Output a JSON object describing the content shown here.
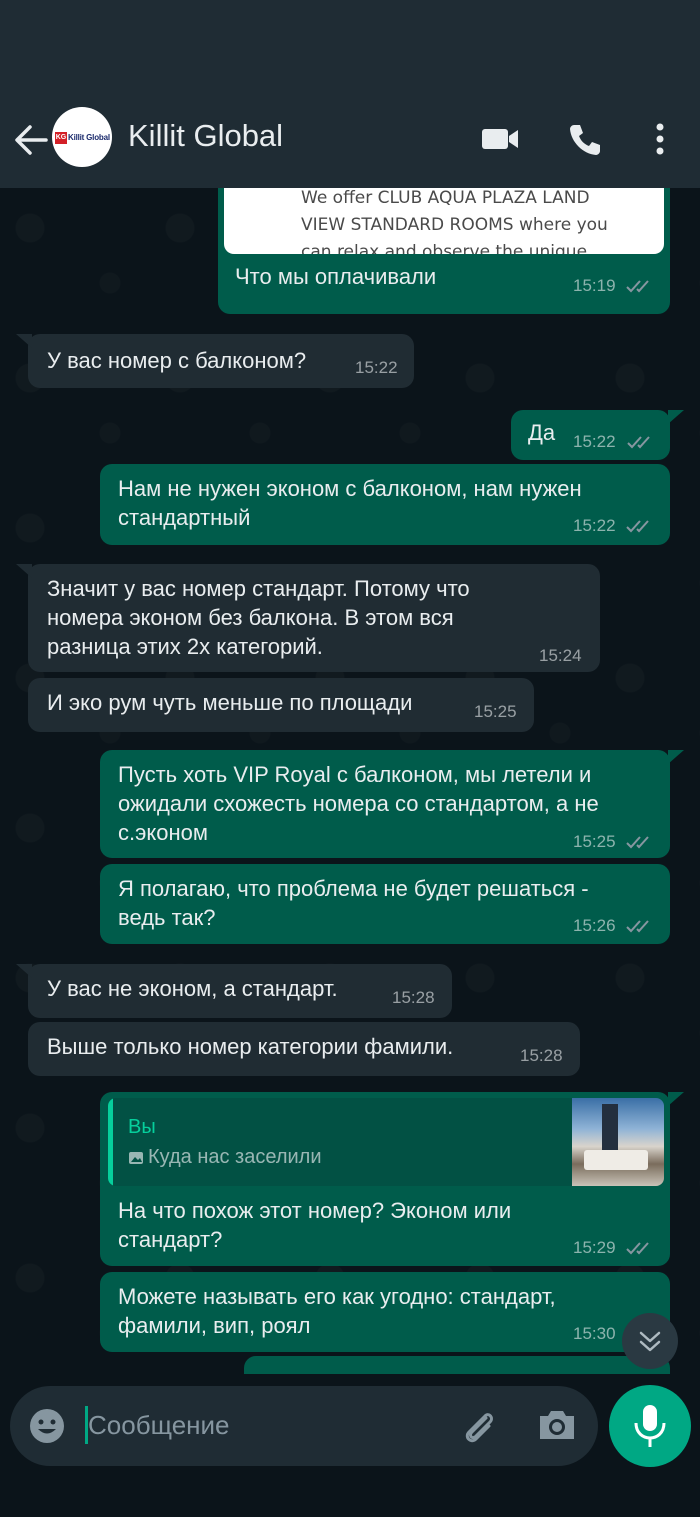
{
  "header": {
    "contact_name": "Killit Global",
    "avatar_logo_text": "Killit Global",
    "avatar_logo_mark": "KG"
  },
  "messages": [
    {
      "dir": "out",
      "preview_lines": [
        "We offer CLUB AQUA PLAZA LAND",
        "VIEW STANDARD ROOMS where you",
        "can relax and observe the unique"
      ],
      "text": "Что мы оплачивали",
      "time": "15:19"
    },
    {
      "dir": "in",
      "text": "У вас номер с балконом?",
      "time": "15:22"
    },
    {
      "dir": "out",
      "text": "Да",
      "time": "15:22"
    },
    {
      "dir": "out",
      "lines": [
        "Нам не нужен эконом с балконом, нам нужен",
        "стандартный"
      ],
      "time": "15:22"
    },
    {
      "dir": "in",
      "lines": [
        "Значит у вас номер стандарт. Потому что",
        "номера эконом без балкона. В этом вся",
        "разница этих 2х категорий."
      ],
      "time": "15:24"
    },
    {
      "dir": "in",
      "text": "И эко рум чуть меньше по площади",
      "time": "15:25"
    },
    {
      "dir": "out",
      "lines": [
        "Пусть хоть VIP Royal с балконом, мы летели и",
        "ожидали схожесть номера со стандартом, а не",
        "с.эконом"
      ],
      "time": "15:25"
    },
    {
      "dir": "out",
      "lines": [
        "Я полагаю, что проблема не будет решаться -",
        "ведь так?"
      ],
      "time": "15:26"
    },
    {
      "dir": "in",
      "text": "У вас не эконом, а стандарт.",
      "time": "15:28"
    },
    {
      "dir": "in",
      "text": "Выше только номер категории фамили.",
      "time": "15:28"
    },
    {
      "dir": "out",
      "reply_to": {
        "author": "Вы",
        "text": "Куда нас заселили"
      },
      "lines": [
        "На что похож этот номер? Эконом или",
        "стандарт?"
      ],
      "time": "15:29"
    },
    {
      "dir": "out",
      "lines": [
        "Можете называть его как угодно: стандарт,",
        "фамили, вип, роял"
      ],
      "time": "15:30"
    }
  ],
  "input": {
    "placeholder": "Сообщение"
  },
  "icons": {
    "back": "arrow-left-icon",
    "video": "video-call-icon",
    "call": "phone-icon",
    "menu": "more-vertical-icon",
    "emoji": "emoji-icon",
    "attach": "paperclip-icon",
    "camera": "camera-icon",
    "mic": "microphone-icon",
    "scroll": "double-chevron-down-icon"
  },
  "colors": {
    "outgoing_bubble": "#005c4b",
    "incoming_bubble": "#202c33",
    "accent": "#00a884",
    "read_ticks": "#8696a0"
  }
}
